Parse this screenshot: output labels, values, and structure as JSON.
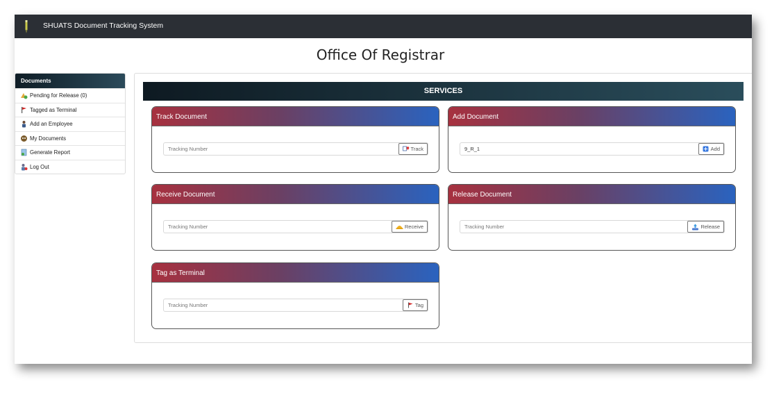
{
  "navbar": {
    "title": "SHUATS Document Tracking System",
    "logo_icon": "pen-icon"
  },
  "page": {
    "title": "Office Of Registrar"
  },
  "sidebar": {
    "header": "Documents",
    "items": [
      {
        "label": "Pending for Release (0)",
        "icon": "pending-icon"
      },
      {
        "label": "Tagged as Terminal",
        "icon": "flag-icon"
      },
      {
        "label": "Add an Employee",
        "icon": "employee-icon"
      },
      {
        "label": "My Documents",
        "icon": "documents-icon"
      },
      {
        "label": "Generate Report",
        "icon": "report-icon"
      },
      {
        "label": "Log Out",
        "icon": "logout-icon"
      }
    ]
  },
  "services": {
    "title": "SERVICES",
    "cards": [
      {
        "title": "Track Document",
        "placeholder": "Tracking Number",
        "value": "",
        "button": "Track"
      },
      {
        "title": "Add Document",
        "placeholder": "",
        "value": "9_R_1",
        "button": "Add"
      },
      {
        "title": "Receive Document",
        "placeholder": "Tracking Number",
        "value": "",
        "button": "Receive"
      },
      {
        "title": "Release Document",
        "placeholder": "Tracking Number",
        "value": "",
        "button": "Release"
      },
      {
        "title": "Tag as Terminal",
        "placeholder": "Tracking Number",
        "value": "",
        "button": "Tag"
      }
    ]
  },
  "colors": {
    "navbar": "#2b2f35",
    "header_start": "#a7313f",
    "header_end": "#2a63bf",
    "sidebar_header": "#0f1d26"
  }
}
